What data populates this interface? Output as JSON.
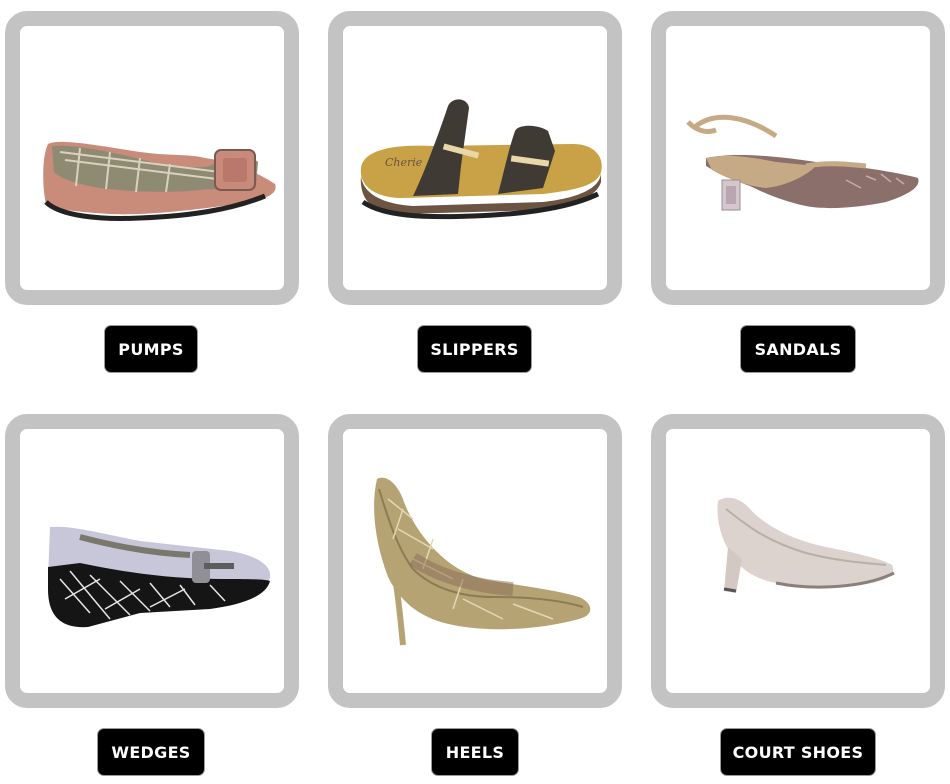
{
  "categories": [
    {
      "label": "PUMPS",
      "icon": "pump-shoe-image"
    },
    {
      "label": "SLIPPERS",
      "icon": "slipper-image"
    },
    {
      "label": "SANDALS",
      "icon": "sandal-image"
    },
    {
      "label": "WEDGES",
      "icon": "wedge-shoe-image"
    },
    {
      "label": "HEELS",
      "icon": "heel-shoe-image"
    },
    {
      "label": "COURT SHOES",
      "icon": "court-shoe-image"
    }
  ],
  "colors": {
    "card_border": "#c3c3c3",
    "button_bg": "#000000",
    "button_text": "#ffffff"
  }
}
